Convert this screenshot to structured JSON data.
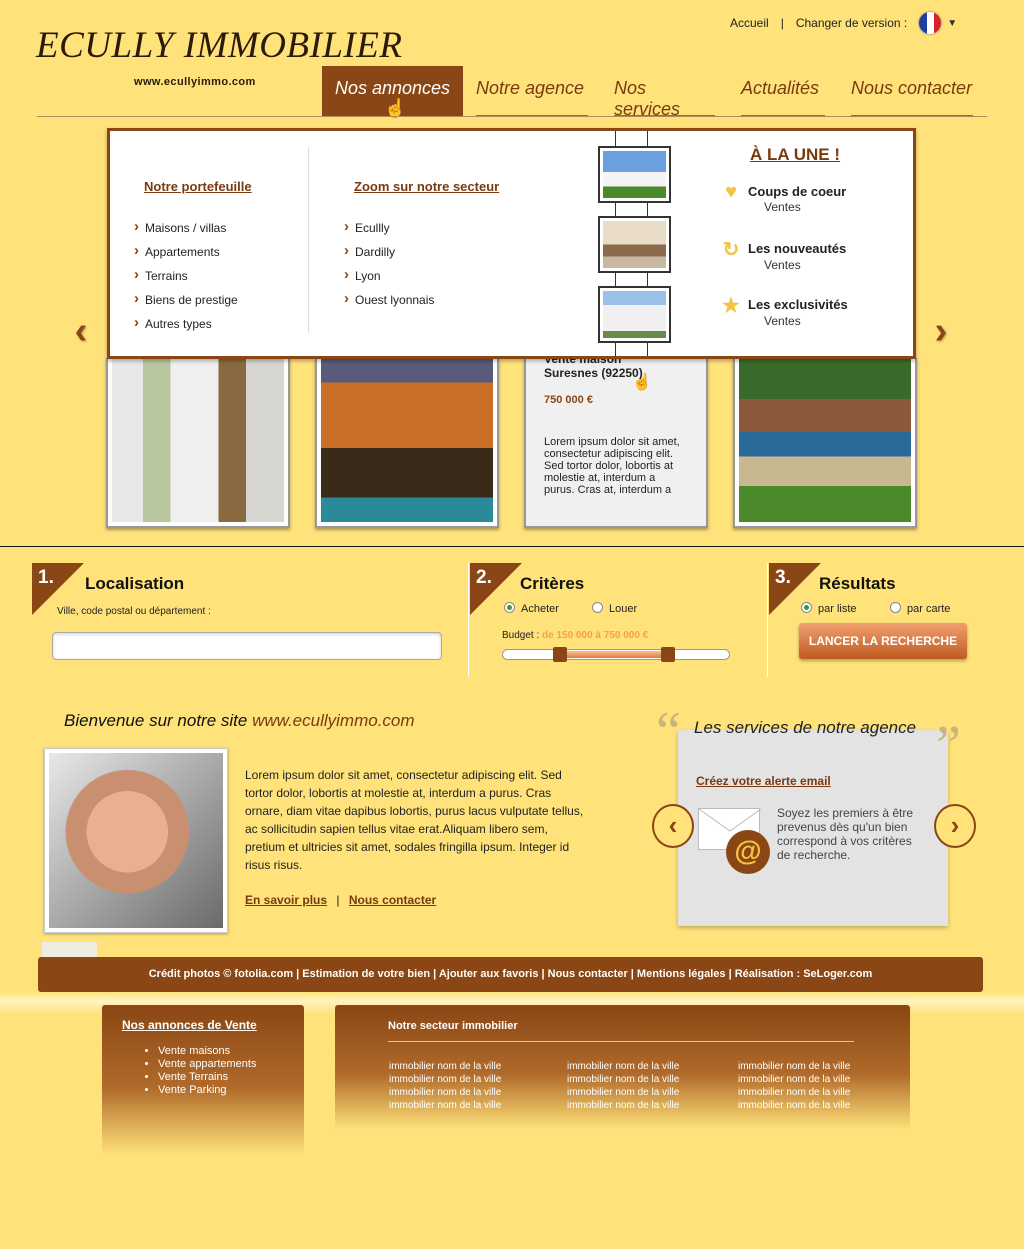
{
  "header": {
    "logo": "ECULLY IMMOBILIER",
    "site_url": "www.ecullyimmo.com",
    "top_links": {
      "home": "Accueil",
      "separator": "|",
      "change_version": "Changer de version :"
    }
  },
  "nav": {
    "items": [
      {
        "label": "Nos annonces"
      },
      {
        "label": "Notre agence"
      },
      {
        "label": "Nos services"
      },
      {
        "label": "Actualités"
      },
      {
        "label": "Nous contacter"
      }
    ]
  },
  "mega_menu": {
    "col1": {
      "title": "Notre portefeuille",
      "items": [
        "Maisons / villas",
        "Appartements",
        "Terrains",
        "Biens de prestige",
        "Autres types"
      ]
    },
    "col2": {
      "title": "Zoom sur notre secteur",
      "items": [
        "Ecullly",
        "Dardilly",
        "Lyon",
        "Ouest lyonnais"
      ]
    },
    "une": {
      "title": "À LA UNE !",
      "items": [
        {
          "label": "Coups de coeur",
          "sub": "Ventes"
        },
        {
          "label": "Les nouveautés",
          "sub": "Ventes"
        },
        {
          "label": "Les exclusivités",
          "sub": "Ventes"
        }
      ]
    }
  },
  "carousel": {
    "text_card": {
      "title_line1": "Vente maison",
      "title_line2": "Suresnes (92250)",
      "price": "750 000 €",
      "desc": "Lorem ipsum dolor sit amet, consectetur adipiscing elit. Sed tortor dolor, lobortis at molestie at, interdum a purus. Cras at, interdum a"
    }
  },
  "search": {
    "step1": {
      "num": "1.",
      "title": "Localisation",
      "label": "Ville, code postal ou département :",
      "value": ""
    },
    "step2": {
      "num": "2.",
      "title": "Critères",
      "opt_buy": "Acheter",
      "opt_rent": "Louer",
      "budget_label": "Budget :",
      "budget_range": "de 150 000 à 750 000 €",
      "budget_min_fraction": 0.25,
      "budget_max_fraction": 0.73
    },
    "step3": {
      "num": "3.",
      "title": "Résultats",
      "opt_list": "par liste",
      "opt_map": "par carte",
      "button": "LANCER LA RECHERCHE"
    }
  },
  "welcome": {
    "title_prefix": "Bienvenue sur notre site ",
    "title_url": "www.ecullyimmo.com",
    "body": "Lorem ipsum dolor sit amet, consectetur adipiscing elit. Sed tortor dolor, lobortis at molestie at, interdum a purus. Cras ornare, diam vitae dapibus lobortis, purus lacus vulputate tellus, ac sollicitudin sapien tellus vitae erat.Aliquam libero sem, pretium et ultricies sit amet, sodales fringilla ipsum. Integer id risus risus.",
    "link_more": "En savoir plus",
    "link_sep": "|",
    "link_contact": "Nous contacter"
  },
  "services": {
    "title": "Les services de notre agence",
    "link": "Créez votre alerte email",
    "text": "Soyez les premiers à être prevenus dès qu'un bien correspond à vos critères de recherche."
  },
  "footer": {
    "bar": "Crédit photos © fotolia.com | Estimation de votre bien | Ajouter aux favoris | Nous contacter | Mentions légales | Réalisation : SeLoger.com",
    "box1": {
      "title": "Nos annonces de Vente",
      "items": [
        "Vente maisons",
        "Vente appartements",
        "Vente Terrains",
        "Vente Parking"
      ]
    },
    "box2": {
      "title": "Notre secteur immobilier",
      "link_text": "immobilier nom de la ville"
    }
  }
}
